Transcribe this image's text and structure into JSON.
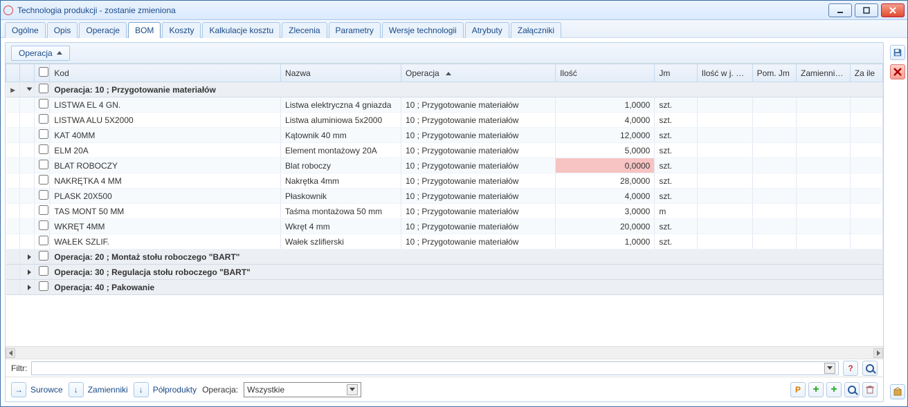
{
  "window": {
    "title": "Technologia produkcji - zostanie zmieniona"
  },
  "tabs": {
    "items": [
      "Ogólne",
      "Opis",
      "Operacje",
      "BOM",
      "Koszty",
      "Kalkulacje kosztu",
      "Zlecenia",
      "Parametry",
      "Wersje technologii",
      "Atrybuty",
      "Załączniki"
    ],
    "active_index": 3
  },
  "group_panel": {
    "button_label": "Operacja"
  },
  "columns": {
    "c0": "",
    "c1": "",
    "c2": "",
    "kod": "Kod",
    "nazwa": "Nazwa",
    "operacja": "Operacja",
    "ilosc": "Ilość",
    "jm": "Jm",
    "ilosc_pom": "Ilość w j. pom.",
    "pom_jm": "Pom. Jm",
    "zamiennik": "Zamiennik do",
    "za_ile": "Za ile"
  },
  "groups": [
    {
      "expanded": true,
      "title": "Operacja: 10 ; Przygotowanie materiałów",
      "rows_key": "rows_10"
    },
    {
      "expanded": false,
      "title": "Operacja: 20 ; Montaż stołu roboczego \"BART\""
    },
    {
      "expanded": false,
      "title": "Operacja: 30 ; Regulacja stołu roboczego \"BART\""
    },
    {
      "expanded": false,
      "title": "Operacja: 40 ; Pakowanie"
    }
  ],
  "rows_10": [
    {
      "kod": "LISTWA EL 4 GN.",
      "nazwa": "Listwa elektryczna 4 gniazda",
      "op": "10 ; Przygotowanie materiałów",
      "ilosc": "1,0000",
      "jm": "szt.",
      "pink": false
    },
    {
      "kod": "LISTWA ALU 5X2000",
      "nazwa": "Listwa aluminiowa 5x2000",
      "op": "10 ; Przygotowanie materiałów",
      "ilosc": "4,0000",
      "jm": "szt.",
      "pink": false
    },
    {
      "kod": "KAT 40MM",
      "nazwa": "Kątownik 40 mm",
      "op": "10 ; Przygotowanie materiałów",
      "ilosc": "12,0000",
      "jm": "szt.",
      "pink": false
    },
    {
      "kod": "ELM 20A",
      "nazwa": "Element montażowy 20A",
      "op": "10 ; Przygotowanie materiałów",
      "ilosc": "5,0000",
      "jm": "szt.",
      "pink": false
    },
    {
      "kod": "BLAT ROBOCZY",
      "nazwa": "Blat roboczy",
      "op": "10 ; Przygotowanie materiałów",
      "ilosc": "0,0000",
      "jm": "szt.",
      "pink": true
    },
    {
      "kod": "NAKRĘTKA 4 MM",
      "nazwa": "Nakrętka 4mm",
      "op": "10 ; Przygotowanie materiałów",
      "ilosc": "28,0000",
      "jm": "szt.",
      "pink": false
    },
    {
      "kod": "PLASK 20X500",
      "nazwa": "Płaskownik",
      "op": "10 ; Przygotowanie materiałów",
      "ilosc": "4,0000",
      "jm": "szt.",
      "pink": false
    },
    {
      "kod": "TAS MONT 50 MM",
      "nazwa": "Taśma montażowa 50 mm",
      "op": "10 ; Przygotowanie materiałów",
      "ilosc": "3,0000",
      "jm": "m",
      "pink": false
    },
    {
      "kod": "WKRĘT 4MM",
      "nazwa": "Wkręt 4 mm",
      "op": "10 ; Przygotowanie materiałów",
      "ilosc": "20,0000",
      "jm": "szt.",
      "pink": false
    },
    {
      "kod": "WAŁEK SZLIF.",
      "nazwa": "Wałek szlifierski",
      "op": "10 ; Przygotowanie materiałów",
      "ilosc": "1,0000",
      "jm": "szt.",
      "pink": false
    }
  ],
  "filter": {
    "label": "Filtr:"
  },
  "bottom": {
    "surowce": "Surowce",
    "zamienniki": "Zamienniki",
    "polprodukty": "Półprodukty",
    "operacja_label": "Operacja:",
    "operacja_value": "Wszystkie"
  },
  "sort": {
    "column": "operacja",
    "dir": "asc"
  }
}
